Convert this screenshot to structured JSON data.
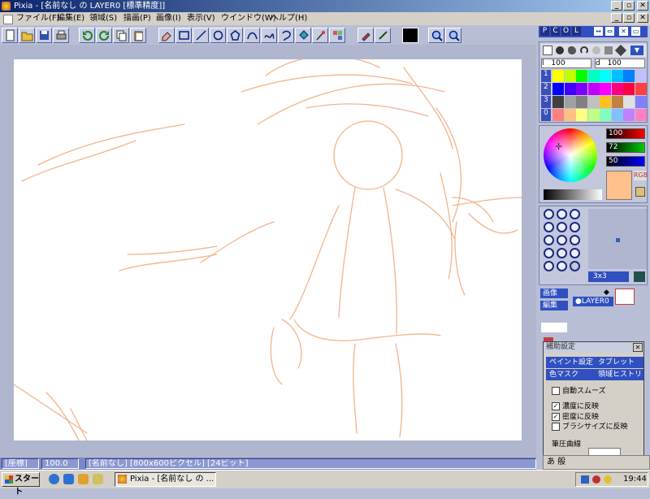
{
  "window": {
    "title": "Pixia - [名前なし の LAYER0 [標準精度]]",
    "minimize": "_",
    "restore": "▫",
    "close": "✕"
  },
  "menu": [
    "ファイル(F)",
    "編集(E)",
    "領域(S)",
    "描画(P)",
    "画像(I)",
    "表示(V)",
    "ウインドウ(W)",
    "ヘルプ(H)"
  ],
  "panel_header": {
    "letters": [
      "P",
      "C",
      "O",
      "L"
    ]
  },
  "brush": {
    "size_label": "l",
    "size_value": "100",
    "density_label": "d",
    "density_value": "100",
    "rows": [
      "1",
      "2",
      "3",
      "0"
    ]
  },
  "color": {
    "r": "100",
    "g": "72",
    "b": "50",
    "rgb_label": "RGB",
    "current": "#ffc08c"
  },
  "brushshape": {
    "size_label": "3x3"
  },
  "layer": {
    "image_tab": "画像",
    "edit_tab": "編集",
    "layer_name": "LAYER0"
  },
  "assist": {
    "title": "補助設定",
    "tabs": [
      "ペイント設定",
      "タブレット",
      "色マスク",
      "領域ヒストリ"
    ],
    "options": [
      {
        "label": "自動スムーズ",
        "checked": false
      },
      {
        "label": "濃度に反映",
        "checked": true
      },
      {
        "label": "密度に反映",
        "checked": true
      },
      {
        "label": "ブラシサイズに反映",
        "checked": false
      }
    ],
    "pressure_label": "筆圧曲線",
    "close": "✕"
  },
  "status": {
    "coord": "[座標]",
    "zoom": "100.0",
    "info": "[名前なし] [800x600ピクセル] [24ビット]"
  },
  "taskbar": {
    "start": "スタート",
    "task": "Pixia - [名前なし の ...",
    "clock": "19:44",
    "ime": "あ 般"
  }
}
